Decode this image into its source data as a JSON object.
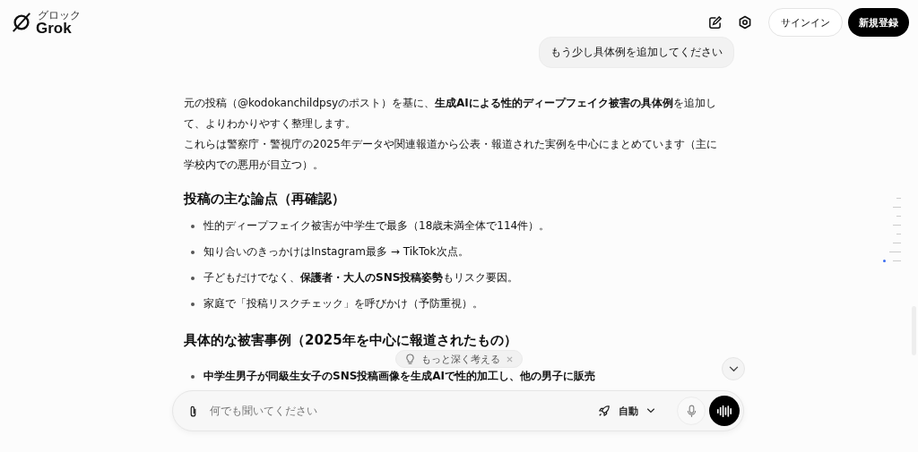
{
  "header": {
    "logo_ruby": "グロック",
    "logo_text": "Grok",
    "sign_in": "サインイン",
    "sign_up": "新規登録"
  },
  "user_message": "もう少し具体例を追加してください",
  "answer": {
    "intro": [
      "元の投稿（@kodokanchildpsyのポスト）を基に、**生成AIによる性的ディープフェイク被害の具体例**を追加して、よりわかりやすく整理します。",
      "これらは警察庁・警視庁の2025年データや関連報道から公表・報道された実例を中心にまとめています（主に学校内での悪用が目立つ）。"
    ],
    "sections": [
      {
        "heading": "投稿の主な論点（再確認）",
        "bullets": [
          {
            "text": "性的ディープフェイク被害が中学生で最多（18歳未満全体で114件）。",
            "bold": false
          },
          {
            "text": "知り合いのきっかけはInstagram最多 → TikTok次点。",
            "bold": false
          },
          {
            "text": "子どもだけでなく、**保護者・大人のSNS投稿姿勢**もリスク要因。",
            "bold": false
          },
          {
            "text": "家庭で「投稿リスクチェック」を呼びかけ（予防重視）。",
            "bold": false
          }
        ]
      },
      {
        "heading": "具体的な被害事例（2025年を中心に報道されたもの）",
        "bullets": [
          {
            "text": "中学生男子が同級生女子のSNS投稿画像を生成AIで性的加工し、他の男子に販売",
            "bold": true
          }
        ]
      }
    ]
  },
  "suggestion": {
    "label": "もっと深く考える"
  },
  "composer": {
    "placeholder": "何でも聞いてください",
    "mode": "自動"
  }
}
